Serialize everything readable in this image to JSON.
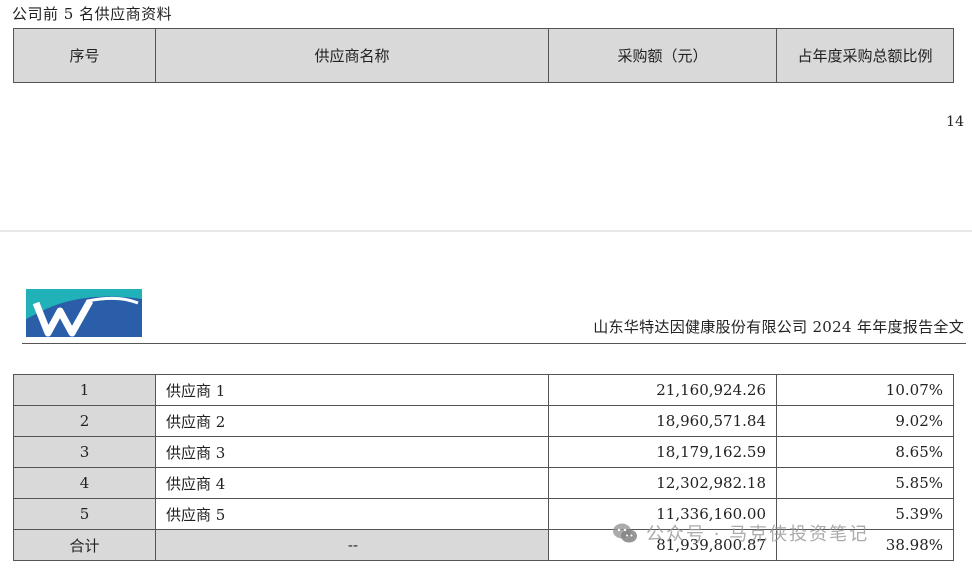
{
  "section_title": "公司前 5 名供应商资料",
  "table_headers": [
    "序号",
    "供应商名称",
    "采购额（元）",
    "占年度采购总额比例"
  ],
  "page_number": "14",
  "report_header": "山东华特达因健康股份有限公司 2024 年年度报告全文",
  "rows": [
    {
      "index": "1",
      "name": "供应商 1",
      "amount": "21,160,924.26",
      "percent": "10.07%"
    },
    {
      "index": "2",
      "name": "供应商 2",
      "amount": "18,960,571.84",
      "percent": "9.02%"
    },
    {
      "index": "3",
      "name": "供应商 3",
      "amount": "18,179,162.59",
      "percent": "8.65%"
    },
    {
      "index": "4",
      "name": "供应商 4",
      "amount": "12,302,982.18",
      "percent": "5.85%"
    },
    {
      "index": "5",
      "name": "供应商 5",
      "amount": "11,336,160.00",
      "percent": "5.39%"
    }
  ],
  "total": {
    "label": "合计",
    "name": "--",
    "amount": "81,939,800.87",
    "percent": "38.98%"
  },
  "watermark": "公众号 · 马克侠投资笔记",
  "colors": {
    "header_bg": "#d9d9d9",
    "logo_blue": "#2a5ea8",
    "logo_teal": "#21b1b8"
  }
}
